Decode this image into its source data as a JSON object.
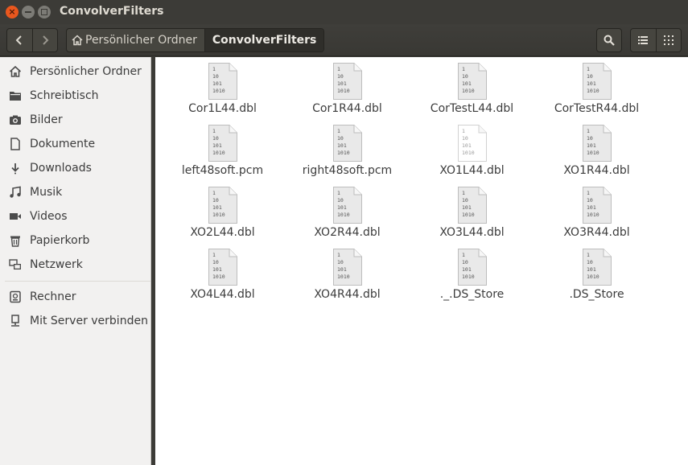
{
  "window": {
    "title": "ConvolverFilters"
  },
  "toolbar": {
    "breadcrumbs": [
      "Persönlicher Ordner",
      "ConvolverFilters"
    ]
  },
  "sidebar": {
    "places": [
      {
        "label": "Persönlicher Ordner",
        "icon": "home-icon"
      },
      {
        "label": "Schreibtisch",
        "icon": "desktop-folder-icon"
      },
      {
        "label": "Bilder",
        "icon": "camera-icon"
      },
      {
        "label": "Dokumente",
        "icon": "document-icon"
      },
      {
        "label": "Downloads",
        "icon": "download-icon"
      },
      {
        "label": "Musik",
        "icon": "music-icon"
      },
      {
        "label": "Videos",
        "icon": "video-icon"
      },
      {
        "label": "Papierkorb",
        "icon": "trash-icon"
      },
      {
        "label": "Netzwerk",
        "icon": "network-icon"
      }
    ],
    "devices": [
      {
        "label": "Rechner",
        "icon": "computer-icon"
      },
      {
        "label": "Mit Server verbinden",
        "icon": "server-connect-icon"
      }
    ]
  },
  "files": [
    {
      "name": "Cor1L44.dbl",
      "icon": "binary-file-icon"
    },
    {
      "name": "Cor1R44.dbl",
      "icon": "binary-file-icon"
    },
    {
      "name": "CorTestL44.dbl",
      "icon": "binary-file-icon"
    },
    {
      "name": "CorTestR44.dbl",
      "icon": "binary-file-icon"
    },
    {
      "name": "left48soft.pcm",
      "icon": "binary-file-icon"
    },
    {
      "name": "right48soft.pcm",
      "icon": "binary-file-icon"
    },
    {
      "name": "XO1L44.dbl",
      "icon": "binary-file-empty-icon"
    },
    {
      "name": "XO1R44.dbl",
      "icon": "binary-file-icon"
    },
    {
      "name": "XO2L44.dbl",
      "icon": "binary-file-icon"
    },
    {
      "name": "XO2R44.dbl",
      "icon": "binary-file-icon"
    },
    {
      "name": "XO3L44.dbl",
      "icon": "binary-file-icon"
    },
    {
      "name": "XO3R44.dbl",
      "icon": "binary-file-icon"
    },
    {
      "name": "XO4L44.dbl",
      "icon": "binary-file-icon"
    },
    {
      "name": "XO4R44.dbl",
      "icon": "binary-file-icon"
    },
    {
      "name": "._.DS_Store",
      "icon": "binary-file-icon"
    },
    {
      "name": ".DS_Store",
      "icon": "binary-file-icon"
    }
  ],
  "colors": {
    "titlebar": "#3c3b37",
    "close_button": "#e9571e",
    "sidebar_bg": "#f2f1f0",
    "main_bg": "#ffffff"
  }
}
